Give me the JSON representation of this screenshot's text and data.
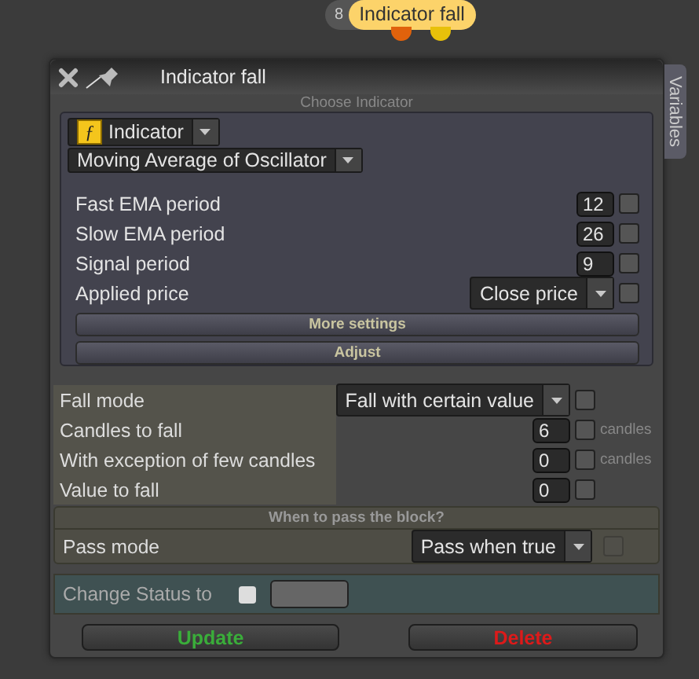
{
  "node": {
    "badge": "8",
    "title": "Indicator fall",
    "ports": [
      {
        "color": "#e0620c"
      },
      {
        "color": "#e8c10a"
      }
    ]
  },
  "panel": {
    "title": "Indicator fall",
    "side_tab": "Variables"
  },
  "indicator_section": {
    "header": "Choose Indicator",
    "category_icon": "ƒ",
    "category": "Indicator",
    "indicator": "Moving Average of Oscillator",
    "params": [
      {
        "kind": "number",
        "label": "Fast EMA period",
        "value": "12",
        "checked": false
      },
      {
        "kind": "number",
        "label": "Slow EMA period",
        "value": "26",
        "checked": false
      },
      {
        "kind": "number",
        "label": "Signal period",
        "value": "9",
        "checked": false
      },
      {
        "kind": "select",
        "label": "Applied price",
        "value": "Close price",
        "checked": false
      }
    ],
    "buttons": [
      "More settings",
      "Adjust"
    ]
  },
  "fall_params": [
    {
      "kind": "select",
      "label": "Fall mode",
      "value": "Fall with certain value",
      "checked": false
    },
    {
      "kind": "number",
      "label": "Candles to fall",
      "value": "6",
      "checked": false,
      "unit": "candles"
    },
    {
      "kind": "number",
      "label": "With exception of few candles",
      "value": "0",
      "checked": false,
      "unit": "candles"
    },
    {
      "kind": "number",
      "label": "Value to fall",
      "value": "0",
      "checked": false
    }
  ],
  "pass_section": {
    "header": "When to pass the block?",
    "label": "Pass mode",
    "value": "Pass when true",
    "checked": false,
    "disabled": true
  },
  "status": {
    "label": "Change Status to",
    "checked": false
  },
  "actions": [
    {
      "kind": "update",
      "label": "Update"
    },
    {
      "kind": "delete",
      "label": "Delete"
    }
  ]
}
